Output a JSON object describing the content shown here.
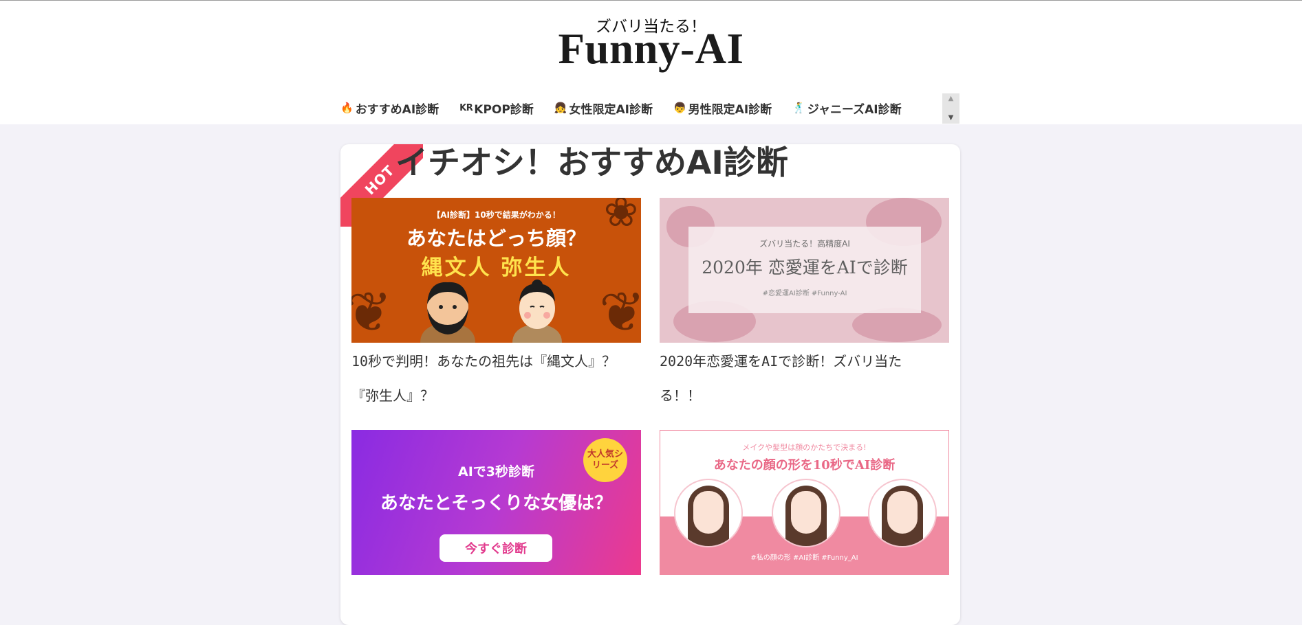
{
  "header": {
    "tagline": "ズバリ当たる！",
    "logo": "Funny-AI"
  },
  "nav": {
    "items": [
      {
        "icon": "fire-icon",
        "glyph": "🔥",
        "label": "おすすめAI診断"
      },
      {
        "icon": "kr-flag-icon",
        "glyph": "KR",
        "label": "KPOP診断"
      },
      {
        "icon": "girl-face-icon",
        "glyph": "👧",
        "label": "女性限定AI診断"
      },
      {
        "icon": "boy-face-icon",
        "glyph": "👦",
        "label": "男性限定AI診断"
      },
      {
        "icon": "dancer-icon",
        "glyph": "🕺",
        "label": "ジャニーズAI診断"
      }
    ],
    "scroll_up": "▲",
    "scroll_down": "▼"
  },
  "section": {
    "ribbon": "HOT",
    "title": "イチオシ！おすすめAI診断"
  },
  "cards": [
    {
      "caption_line1": "10秒で判明！あなたの祖先は『縄文人』？",
      "caption_line2": "『弥生人』？",
      "thumb": {
        "sub": "【AI診断】10秒で結果がわかる！",
        "main": "あなたはどっち顔？",
        "accent": "縄文人  弥生人"
      }
    },
    {
      "caption_line1": "2020年恋愛運をAIで診断！ズバリ当た",
      "caption_line2": "る！！",
      "thumb": {
        "sub": "ズバリ当たる！高精度AI",
        "main": "2020年 恋愛運をAIで診断",
        "tag": "#恋愛運AI診断 #Funny-AI"
      }
    },
    {
      "caption_line1": "",
      "caption_line2": "",
      "thumb": {
        "badge": "大人気シリーズ",
        "line1": "AIで3秒診断",
        "line2": "あなたとそっくりな女優は？",
        "cta": "今すぐ診断"
      }
    },
    {
      "caption_line1": "",
      "caption_line2": "",
      "thumb": {
        "sub": "メイクや髪型は顔のかたちで決まる!",
        "main": "あなたの顔の形を10秒でAI診断",
        "tag": "#私の顔の形 #AI診断 #Funny_AI"
      }
    }
  ],
  "colors": {
    "background": "#f3f2f8",
    "ribbon": "#f0455e",
    "thumb1": "#c8520a",
    "thumb4_accent": "#f08aa1"
  }
}
